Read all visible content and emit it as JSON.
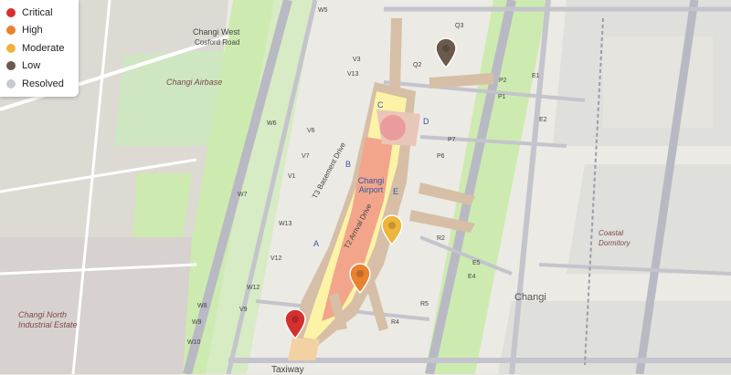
{
  "legend": {
    "items": [
      {
        "label": "Critical",
        "color": "#d62f2f"
      },
      {
        "label": "High",
        "color": "#e8822f"
      },
      {
        "label": "Moderate",
        "color": "#eeb43b"
      },
      {
        "label": "Low",
        "color": "#6b5a4b"
      },
      {
        "label": "Resolved",
        "color": "#c7cbd3"
      }
    ]
  },
  "labels": {
    "changi_west": "Changi West",
    "cosford_road": "Cosford Road",
    "changi_airbase": "Changi Airbase",
    "changi_airport": "Changi Airport",
    "changi_town": "Changi",
    "north_industrial": "Changi North Industrial Estate",
    "coastal_dormitory": "Coastal Dormitory",
    "taxiway": "Taxiway",
    "basement_drive": "T3 Basement Drive",
    "arrival_drive": "T2 Arrival Drive",
    "gate_a": "A",
    "gate_b": "B",
    "gate_c": "C",
    "gate_d": "D",
    "gate_e": "E",
    "road_w5": "W5",
    "road_w6": "W6",
    "road_w7": "W7",
    "road_w8": "W8",
    "road_w9": "W9",
    "road_w10": "W10",
    "road_w12": "W12",
    "road_w13": "W13",
    "road_v1": "V1",
    "road_v3": "V3",
    "road_v6": "V6",
    "road_v7": "V7",
    "road_v9": "V9",
    "road_v12": "V12",
    "road_v13": "V13",
    "road_q2": "Q2",
    "road_q3": "Q3",
    "road_p1": "P1",
    "road_p2": "P2",
    "road_p6": "P6",
    "road_p7": "P7",
    "road_r2": "R2",
    "road_r4": "R4",
    "road_r5": "R5",
    "road_e1": "E1",
    "road_e2": "E2",
    "road_e4": "E4",
    "road_e5": "E5"
  },
  "markers": [
    {
      "severity": "Critical",
      "color": "#d62f2f"
    },
    {
      "severity": "High",
      "color": "#e8822f"
    },
    {
      "severity": "Moderate",
      "color": "#eeb43b"
    },
    {
      "severity": "Low",
      "color": "#6b5a4b"
    }
  ]
}
